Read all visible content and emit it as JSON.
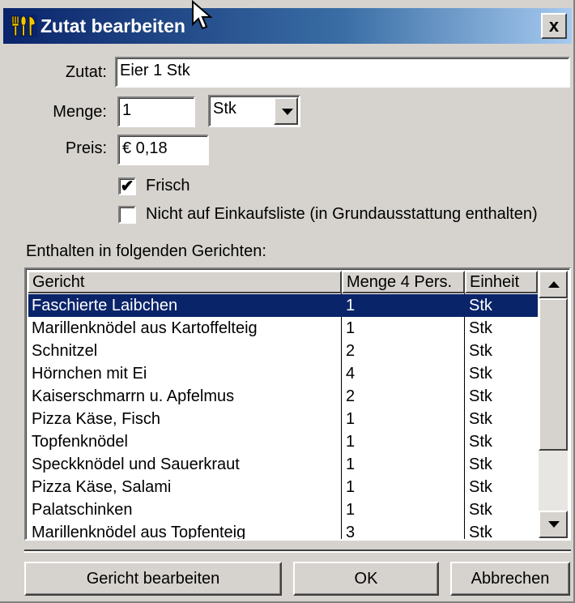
{
  "window": {
    "title": "Zutat bearbeiten",
    "close_label": "x"
  },
  "form": {
    "zutat_label": "Zutat:",
    "zutat_value": "Eier 1 Stk",
    "menge_label": "Menge:",
    "menge_value": "1",
    "unit_value": "Stk",
    "preis_label": "Preis:",
    "preis_value": "€ 0,18",
    "frisch_label": "Frisch",
    "frisch_checked": "✔",
    "einkauf_label": "Nicht auf Einkaufsliste (in Grundausstattung enthalten)"
  },
  "list": {
    "caption": "Enthalten in folgenden Gerichten:",
    "columns": [
      "Gericht",
      "Menge 4 Pers.",
      "Einheit"
    ],
    "rows": [
      [
        "Faschierte Laibchen",
        "1",
        "Stk"
      ],
      [
        "Marillenknödel aus Kartoffelteig",
        "1",
        "Stk"
      ],
      [
        "Schnitzel",
        "2",
        "Stk"
      ],
      [
        "Hörnchen mit Ei",
        "4",
        "Stk"
      ],
      [
        "Kaiserschmarrn u.  Apfelmus",
        "2",
        "Stk"
      ],
      [
        "Pizza Käse, Fisch",
        "1",
        "Stk"
      ],
      [
        "Topfenknödel",
        "1",
        "Stk"
      ],
      [
        "Speckknödel und Sauerkraut",
        "1",
        "Stk"
      ],
      [
        "Pizza Käse, Salami",
        "1",
        "Stk"
      ],
      [
        "Palatschinken",
        "1",
        "Stk"
      ],
      [
        "Marillenknödel aus Topfenteig",
        "3",
        "Stk"
      ]
    ]
  },
  "buttons": {
    "edit_dish": "Gericht bearbeiten",
    "ok": "OK",
    "cancel": "Abbrechen"
  },
  "colors": {
    "title_start": "#0a246a",
    "title_end": "#a6caf0",
    "selection": "#0a246a",
    "face": "#d6d3ce"
  },
  "icons": {
    "title": "cutlery-icon",
    "close": "close-icon",
    "dropdown": "chevron-down-icon",
    "scroll_up": "scroll-up-icon",
    "scroll_down": "scroll-down-icon",
    "cursor": "mouse-cursor-icon"
  }
}
